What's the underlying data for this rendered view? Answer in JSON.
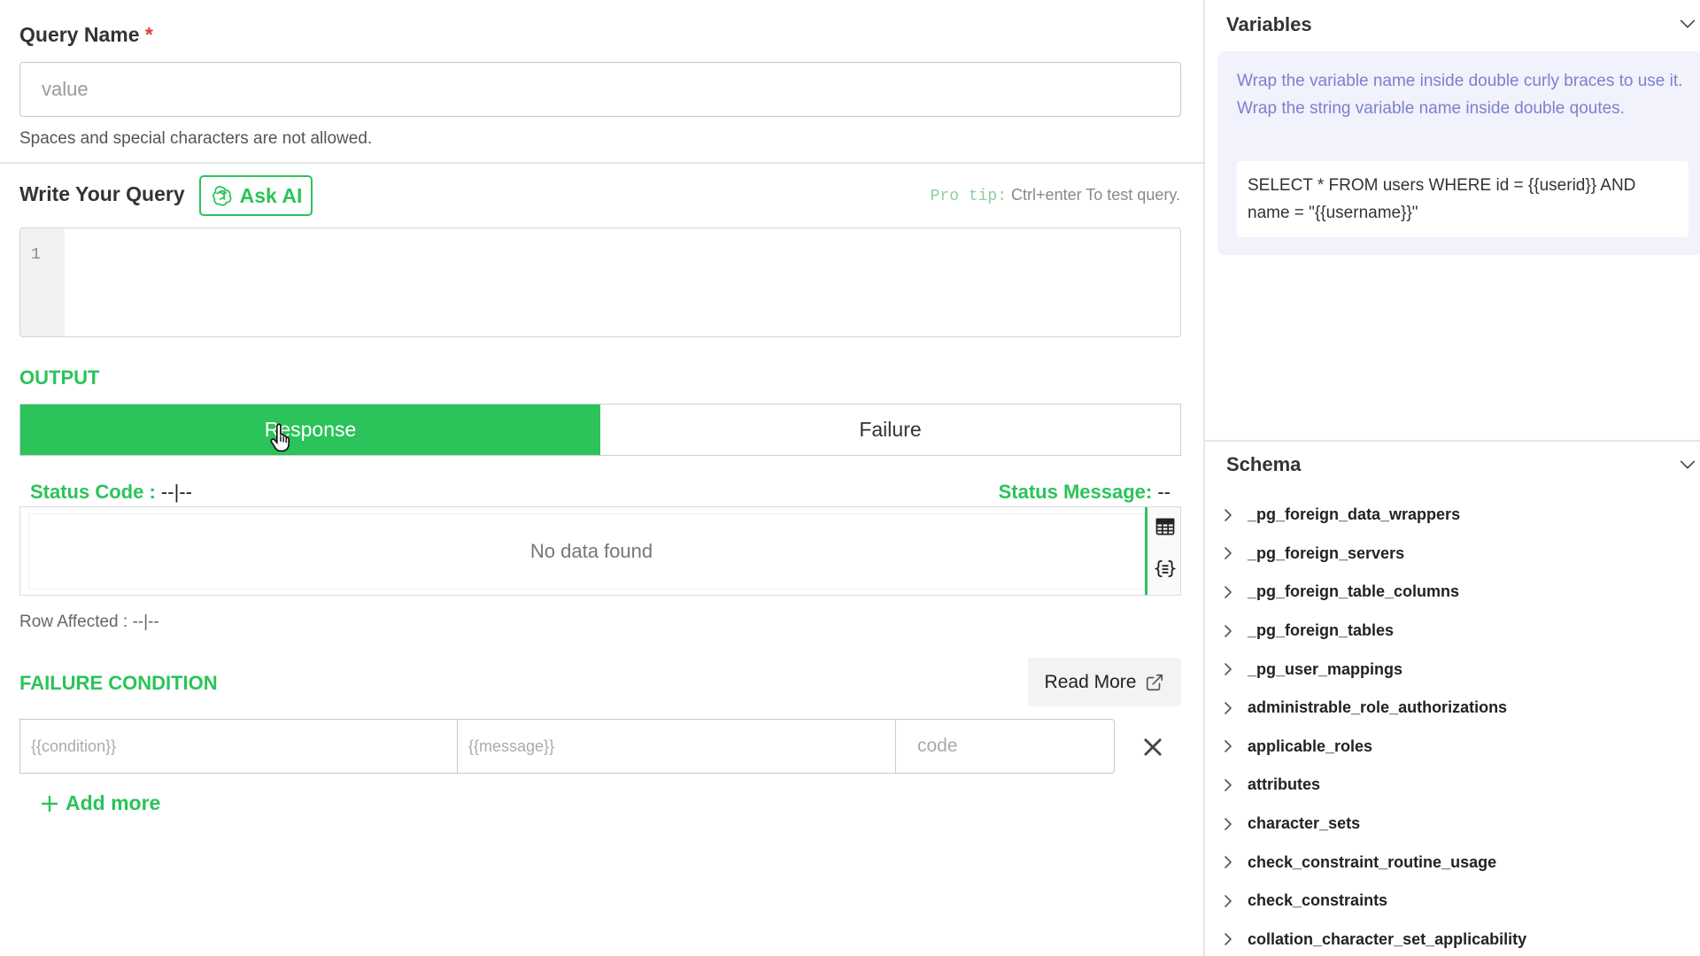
{
  "query_name": {
    "label": "Query Name",
    "required_mark": "*",
    "placeholder": "value",
    "help": "Spaces and special characters are not allowed."
  },
  "write_query": {
    "label": "Write Your Query",
    "ask_ai_label": "Ask AI",
    "pro_tip_prefix": "Pro tip:",
    "pro_tip_keys": "Ctrl+enter",
    "pro_tip_suffix": "To test query.",
    "line_number": "1"
  },
  "output": {
    "label": "OUTPUT",
    "tabs": [
      {
        "label": "Response",
        "active": true
      },
      {
        "label": "Failure",
        "active": false
      }
    ],
    "status_code_label": "Status Code :",
    "status_code_value": "--|--",
    "status_message_label": "Status Message:",
    "status_message_value": "--",
    "no_data": "No data found",
    "row_affected": "Row Affected : --|--"
  },
  "failure_condition": {
    "label": "FAILURE CONDITION",
    "read_more_label": "Read More",
    "condition_placeholder": "{{condition}}",
    "message_placeholder": "{{message}}",
    "code_placeholder": "code",
    "add_more_label": "Add more"
  },
  "variables": {
    "title": "Variables",
    "line1": "Wrap the variable name inside double curly braces to use it.",
    "line2": "Wrap the string variable name inside double qoutes.",
    "example": "SELECT * FROM users WHERE id = {{userid}} AND name = \"{{username}}\""
  },
  "schema": {
    "title": "Schema",
    "items": [
      "_pg_foreign_data_wrappers",
      "_pg_foreign_servers",
      "_pg_foreign_table_columns",
      "_pg_foreign_tables",
      "_pg_user_mappings",
      "administrable_role_authorizations",
      "applicable_roles",
      "attributes",
      "character_sets",
      "check_constraint_routine_usage",
      "check_constraints",
      "collation_character_set_applicability"
    ]
  },
  "colors": {
    "accent": "#2bc35a",
    "variable_text": "#7e7fcf",
    "required": "#e53935"
  },
  "icons": {
    "ask_ai": "openai-icon",
    "read_more": "external-link-icon",
    "table_view": "table-icon",
    "json_view": "json-braces-icon",
    "remove_condition": "close-icon",
    "add_more": "plus-icon",
    "collapse": "chevron-down-icon",
    "expand_item": "chevron-right-icon"
  }
}
